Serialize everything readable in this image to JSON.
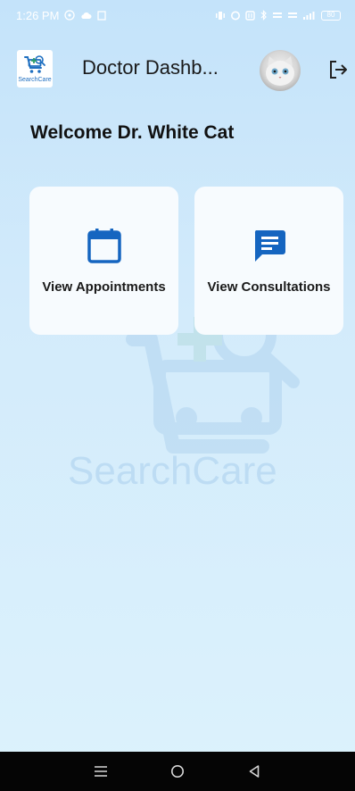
{
  "status_bar": {
    "time": "1:26 PM",
    "battery": "80"
  },
  "app_bar": {
    "logo_text": "SearchCare",
    "title": "Doctor Dashb..."
  },
  "welcome": "Welcome Dr. White Cat",
  "cards": [
    {
      "label": "View Appointments",
      "icon": "calendar-icon"
    },
    {
      "label": "View Consultations",
      "icon": "message-icon"
    }
  ],
  "watermark": {
    "text": "SearchCare"
  },
  "colors": {
    "accent": "#1565c0",
    "background_top": "#c4e3fa",
    "background_bottom": "#dcf2fc",
    "card": "#f7fbfe"
  }
}
